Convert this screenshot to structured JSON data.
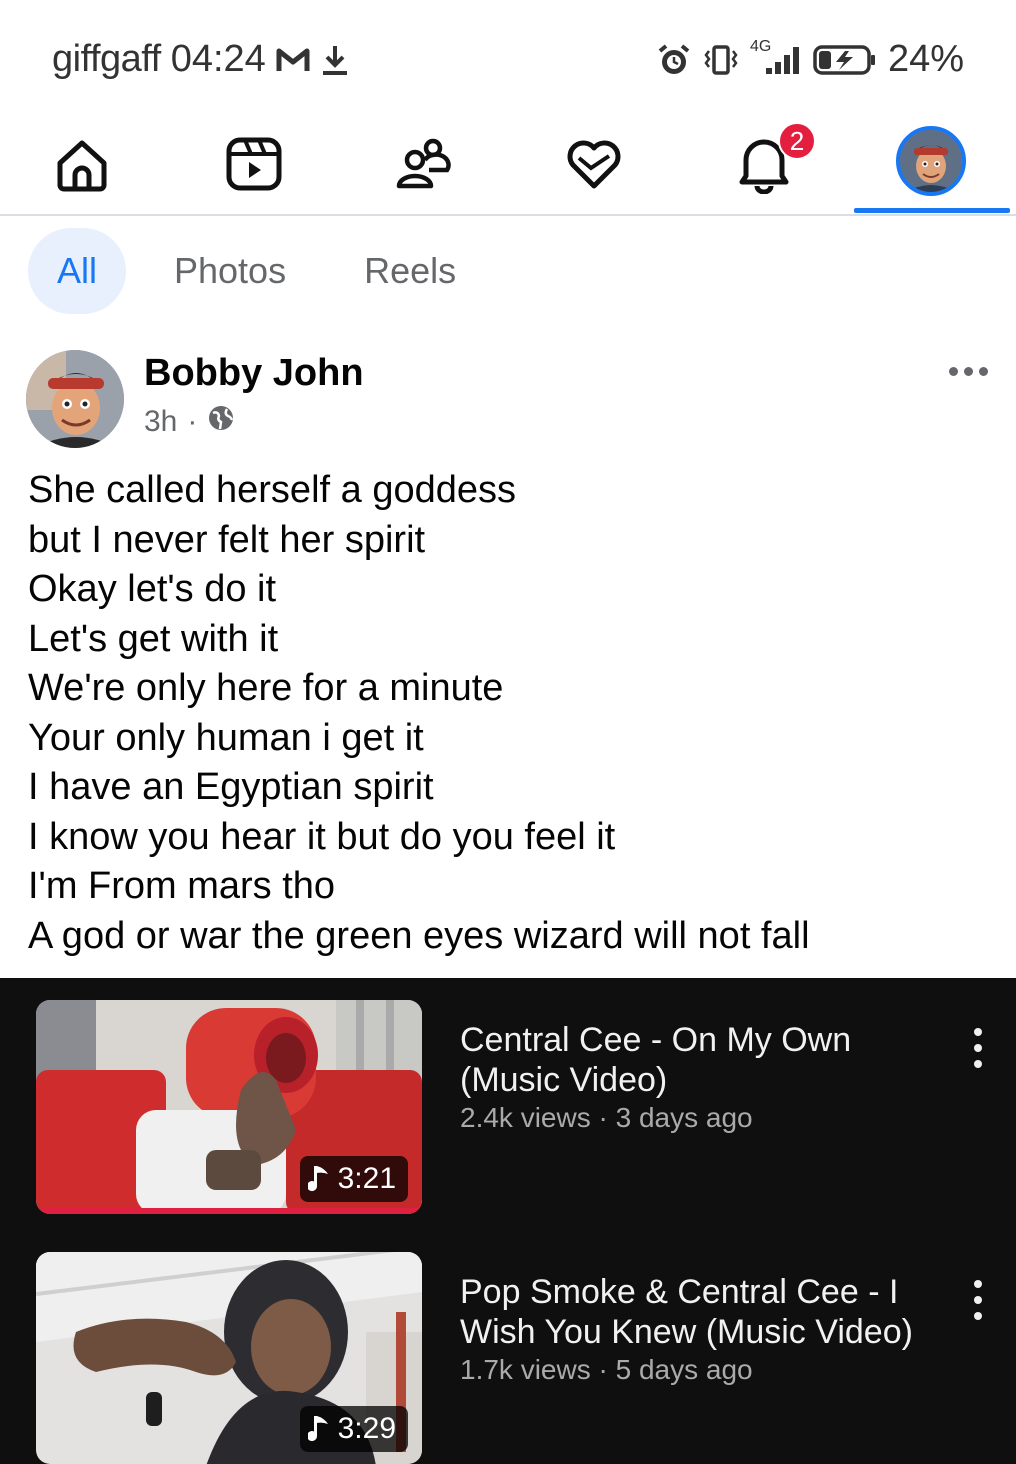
{
  "status_bar": {
    "carrier": "giffgaff",
    "time": "04:24",
    "network": "4G",
    "battery": "24%",
    "icons": [
      "gmail-icon",
      "download-icon",
      "alarm-icon",
      "vibrate-icon",
      "signal-icon",
      "battery-charging-icon"
    ]
  },
  "nav": {
    "items": [
      "home-icon",
      "reels-icon",
      "friends-icon",
      "dating-icon",
      "notifications-icon",
      "profile-avatar"
    ],
    "notification_count": "2",
    "active_item": "profile-avatar",
    "accent_color": "#1877f2",
    "badge_color": "#e41e3f"
  },
  "filters": {
    "items": [
      "All",
      "Photos",
      "Reels"
    ],
    "selected": "All"
  },
  "post": {
    "author": "Bobby John",
    "time": "3h",
    "separator": "·",
    "privacy_icon": "globe-icon",
    "lines": [
      "She called herself a goddess",
      "but I never felt her spirit",
      "Okay let's do it",
      "Let's get with it",
      "We're only here for a minute",
      "Your only human i get it",
      "I have an Egyptian spirit",
      "I know you hear it but do you feel it",
      "I'm From mars tho",
      "A god or war the green eyes wizard will not fall"
    ]
  },
  "videos": [
    {
      "title": "Central Cee - On My Own (Music Video)",
      "views": "2.4k views",
      "age": "3 days ago",
      "duration": "3:21",
      "watched_fraction": 1.0
    },
    {
      "title": "Pop Smoke & Central Cee - I Wish You Knew (Music Video)",
      "views": "1.7k views",
      "age": "5 days ago",
      "duration": "3:29"
    }
  ],
  "separator_dot": "·"
}
